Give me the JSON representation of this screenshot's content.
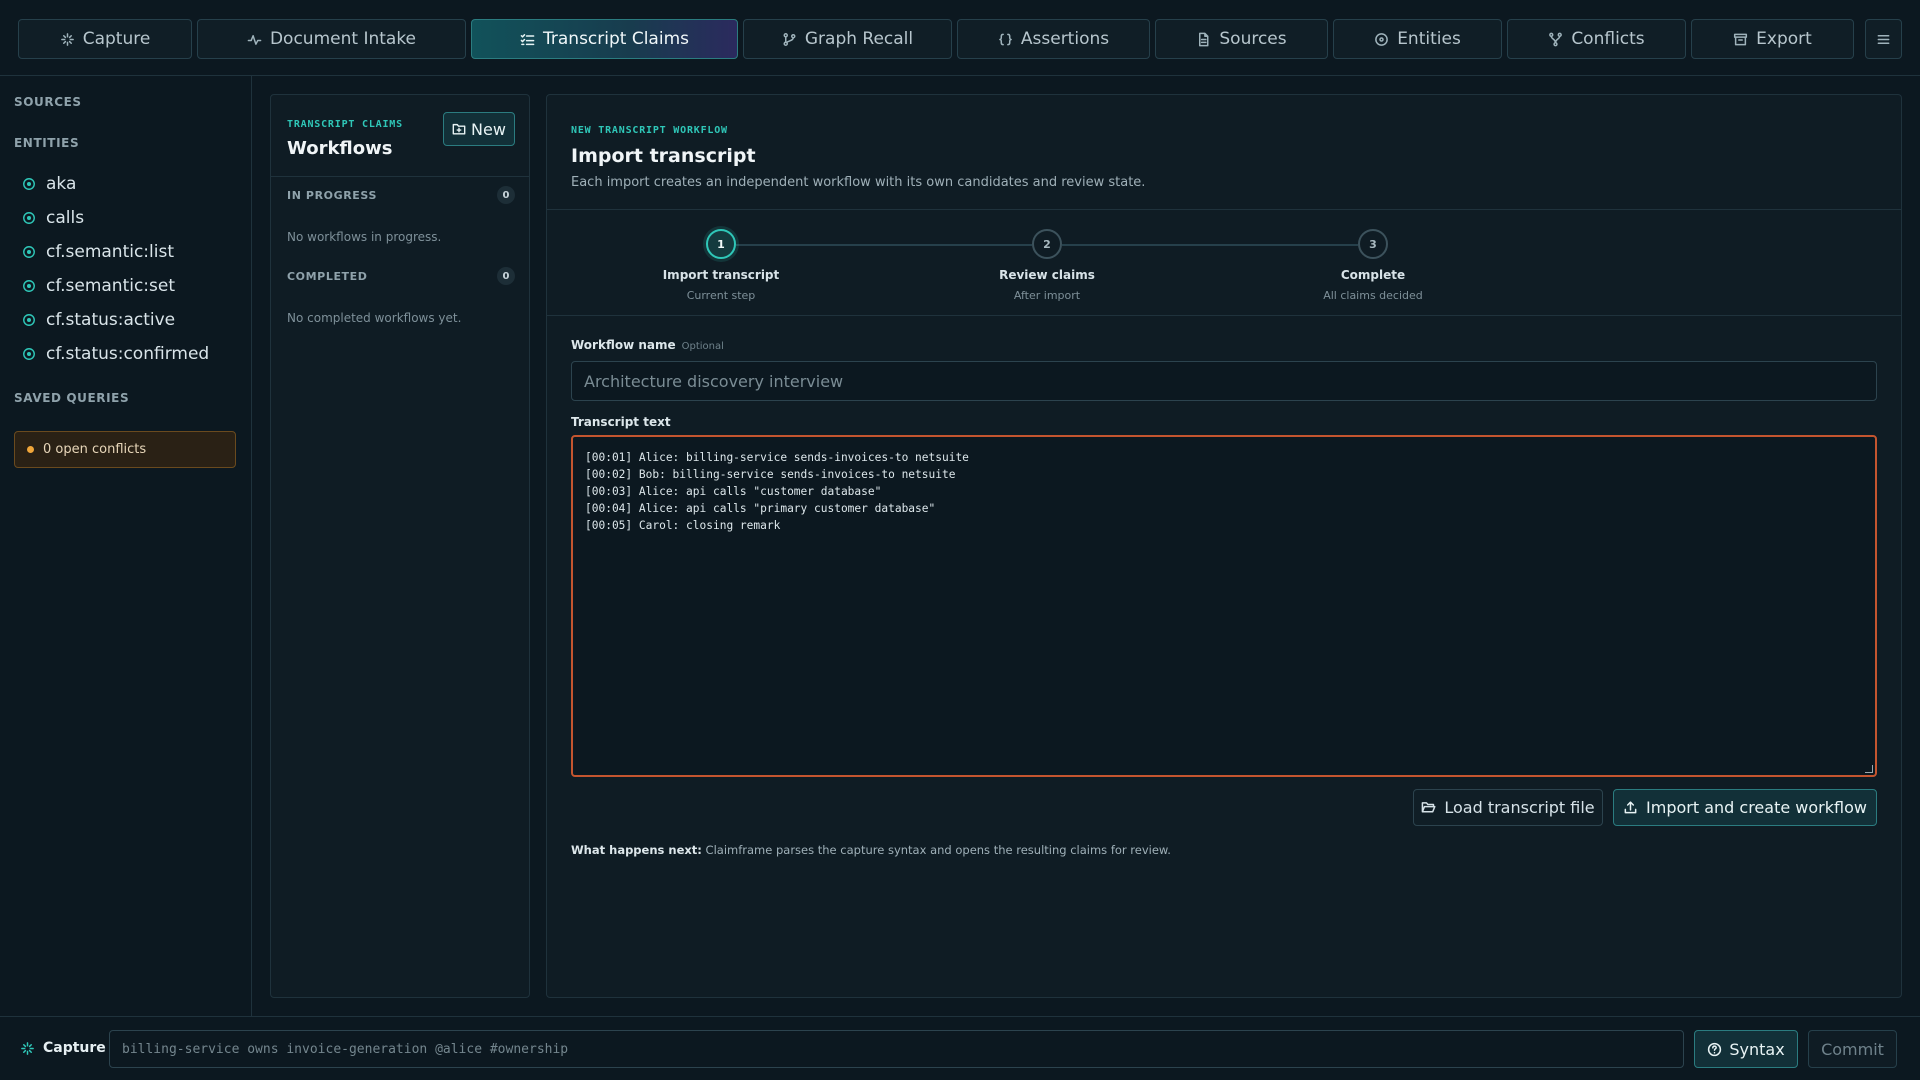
{
  "nav": {
    "tabs": [
      {
        "label": "Capture",
        "icon": "sparkle-icon"
      },
      {
        "label": "Document Intake",
        "icon": "activity-icon"
      },
      {
        "label": "Transcript Claims",
        "icon": "list-check-icon",
        "active": true
      },
      {
        "label": "Graph Recall",
        "icon": "git-branch-icon"
      },
      {
        "label": "Assertions",
        "icon": "braces-icon"
      },
      {
        "label": "Sources",
        "icon": "file-icon"
      },
      {
        "label": "Entities",
        "icon": "target-icon"
      },
      {
        "label": "Conflicts",
        "icon": "git-fork-icon"
      },
      {
        "label": "Export",
        "icon": "archive-icon"
      }
    ],
    "menu_icon": "hamburger-icon"
  },
  "sidebar": {
    "sources_heading": "SOURCES",
    "entities_heading": "ENTITIES",
    "entities": [
      "aka",
      "calls",
      "cf.semantic:list",
      "cf.semantic:set",
      "cf.status:active",
      "cf.status:confirmed"
    ],
    "saved_queries_heading": "SAVED QUERIES",
    "conflicts_badge": "0 open conflicts"
  },
  "workflows": {
    "eyebrow": "TRANSCRIPT CLAIMS",
    "title": "Workflows",
    "new_label": "New",
    "in_progress": {
      "label": "IN PROGRESS",
      "count": "0",
      "empty": "No workflows in progress."
    },
    "completed": {
      "label": "COMPLETED",
      "count": "0",
      "empty": "No completed workflows yet."
    }
  },
  "main": {
    "eyebrow": "NEW TRANSCRIPT WORKFLOW",
    "title": "Import transcript",
    "description": "Each import creates an independent workflow with its own candidates and review state.",
    "steps": [
      {
        "number": "1",
        "title": "Import transcript",
        "subtitle": "Current step"
      },
      {
        "number": "2",
        "title": "Review claims",
        "subtitle": "After import"
      },
      {
        "number": "3",
        "title": "Complete",
        "subtitle": "All claims decided"
      }
    ],
    "workflow_name_label": "Workflow name",
    "workflow_name_optional": "Optional",
    "workflow_name_placeholder": "Architecture discovery interview",
    "transcript_label": "Transcript text",
    "transcript_lines": [
      "[00:01] Alice: billing-service sends-invoices-to netsuite",
      "[00:02] Bob: billing-service sends-invoices-to netsuite",
      "[00:03] Alice: api calls \"customer database\"",
      "[00:04] Alice: api calls \"primary customer database\"",
      "[00:05] Carol: closing remark"
    ],
    "load_button": "Load transcript file",
    "import_button": "Import and create workflow",
    "next_label": "What happens next:",
    "next_text": "Claimframe parses the capture syntax and opens the resulting claims for review."
  },
  "capture_bar": {
    "label": "Capture",
    "placeholder": "billing-service owns invoice-generation @alice #ownership",
    "syntax_button": "Syntax",
    "commit_button": "Commit"
  },
  "colors": {
    "accent": "#2fc7b8",
    "background": "#0c1820",
    "panel": "#0f1c24",
    "error_border": "#c4552f",
    "warning": "#f0a63a"
  }
}
